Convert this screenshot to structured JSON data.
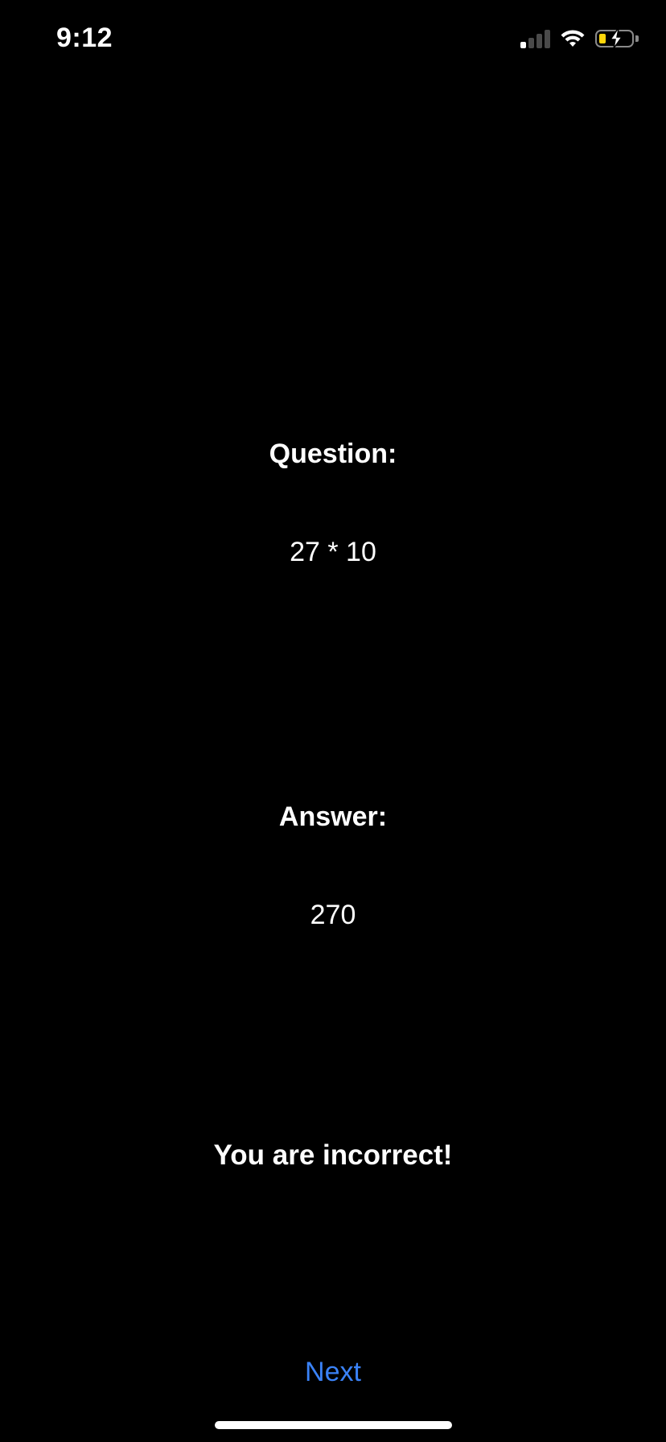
{
  "status_bar": {
    "time": "9:12",
    "signal_icon": "cellular-signal-icon",
    "wifi_icon": "wifi-icon",
    "battery_icon": "battery-charging-icon",
    "battery_level": 0.2,
    "colors": {
      "battery_fill": "#ffd60a"
    }
  },
  "question": {
    "label": "Question:",
    "text": "27 * 10"
  },
  "answer": {
    "label": "Answer:",
    "text": "270"
  },
  "result": {
    "message": "You are incorrect!"
  },
  "actions": {
    "next_label": "Next"
  },
  "colors": {
    "background": "#000000",
    "text": "#ffffff",
    "accent": "#3a82f7"
  }
}
